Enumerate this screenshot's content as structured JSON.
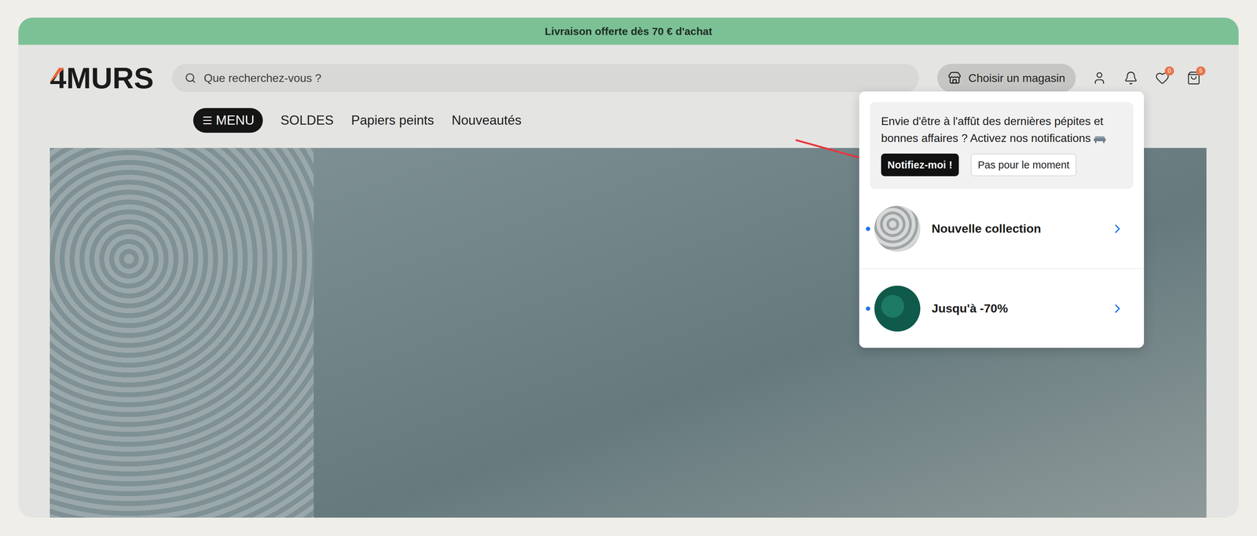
{
  "banner": {
    "text": "Livraison offerte dès 70 € d'achat"
  },
  "logo": {
    "mark": "4",
    "name": "MURS"
  },
  "search": {
    "placeholder": "Que recherchez-vous ?"
  },
  "store_button": {
    "label": "Choisir un magasin"
  },
  "header_actions": {
    "wishlist_badge": "0",
    "cart_badge": "5"
  },
  "nav": {
    "menu_label": "MENU",
    "items": [
      {
        "label": "SOLDES"
      },
      {
        "label": "Papiers peints"
      },
      {
        "label": "Nouveautés"
      }
    ]
  },
  "notification_prompt": {
    "text": "Envie d'être à l'affût des dernières pépites et bonnes affaires ? Activez nos notifications",
    "primary": "Notifiez-moi !",
    "secondary": "Pas pour le moment"
  },
  "notifications": [
    {
      "title": "Nouvelle collection",
      "unread": true,
      "kind": "floral"
    },
    {
      "title": "Jusqu'à -70%",
      "unread": true,
      "kind": "sale"
    }
  ]
}
